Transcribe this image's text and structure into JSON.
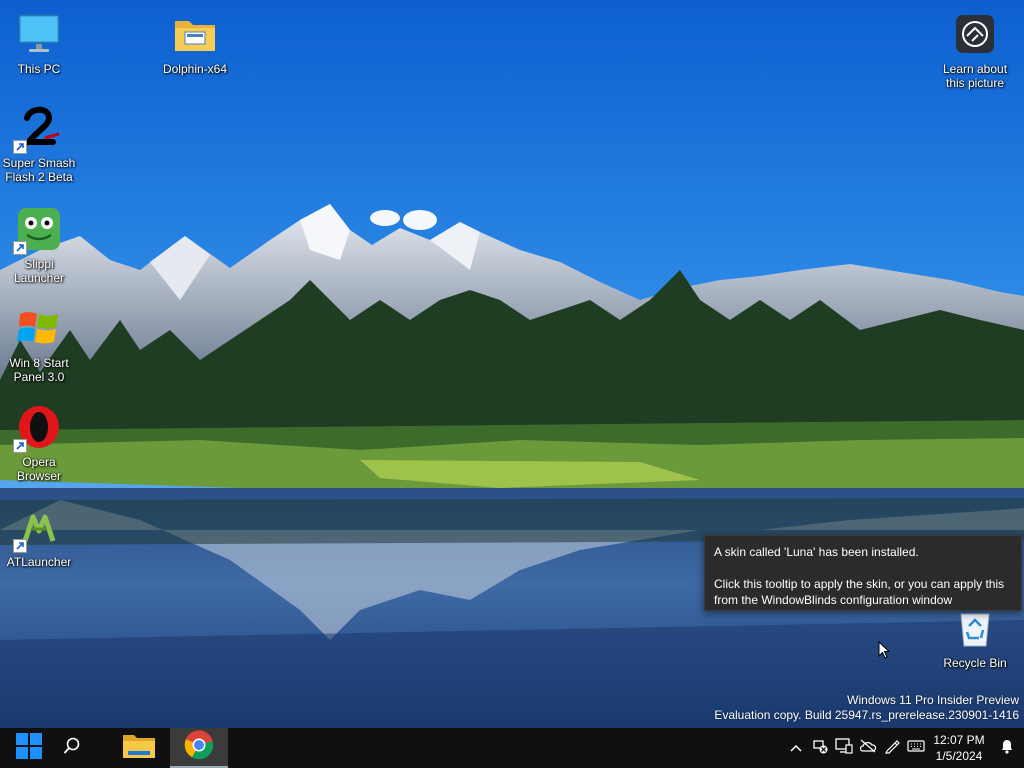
{
  "desktop": {
    "icons": [
      {
        "label": "This PC",
        "icon": "monitor-icon"
      },
      {
        "label": "Dolphin-x64",
        "icon": "folder-icon"
      },
      {
        "label": "Learn about\nthis picture",
        "icon": "camera-icon"
      },
      {
        "label": "Super Smash\nFlash 2 Beta",
        "icon": "ssf2-icon"
      },
      {
        "label": "Slippi\nLauncher",
        "icon": "frog-icon"
      },
      {
        "label": "Win 8 Start\nPanel 3.0",
        "icon": "windows-flag-icon"
      },
      {
        "label": "Opera\nBrowser",
        "icon": "opera-icon"
      },
      {
        "label": "ATLauncher",
        "icon": "atlauncher-icon"
      },
      {
        "label": "Recycle Bin",
        "icon": "recycle-bin-icon"
      }
    ]
  },
  "tooltip": {
    "title": "A skin called 'Luna' has been installed.",
    "body": "Click this tooltip to apply the skin, or you can apply this from the WindowBlinds configuration window"
  },
  "watermark": {
    "line1": "Windows 11 Pro Insider Preview",
    "line2": "Evaluation copy. Build 25947.rs_prerelease.230901-1416"
  },
  "taskbar": {
    "pinned": [
      "windows-start-icon",
      "search-icon",
      "file-explorer-icon",
      "chrome-icon"
    ],
    "tray_icons": [
      "chevron-up-icon",
      "network-disconnected-icon",
      "display-icon",
      "cloud-off-icon",
      "pen-icon",
      "keyboard-icon"
    ],
    "clock": {
      "time": "12:07 PM",
      "date": "1/5/2024"
    },
    "notification_icon": "bell-icon"
  },
  "colors": {
    "sky": "#1f7fe0",
    "taskbar": "#101010",
    "tooltip_bg": "#2b2b2b"
  }
}
